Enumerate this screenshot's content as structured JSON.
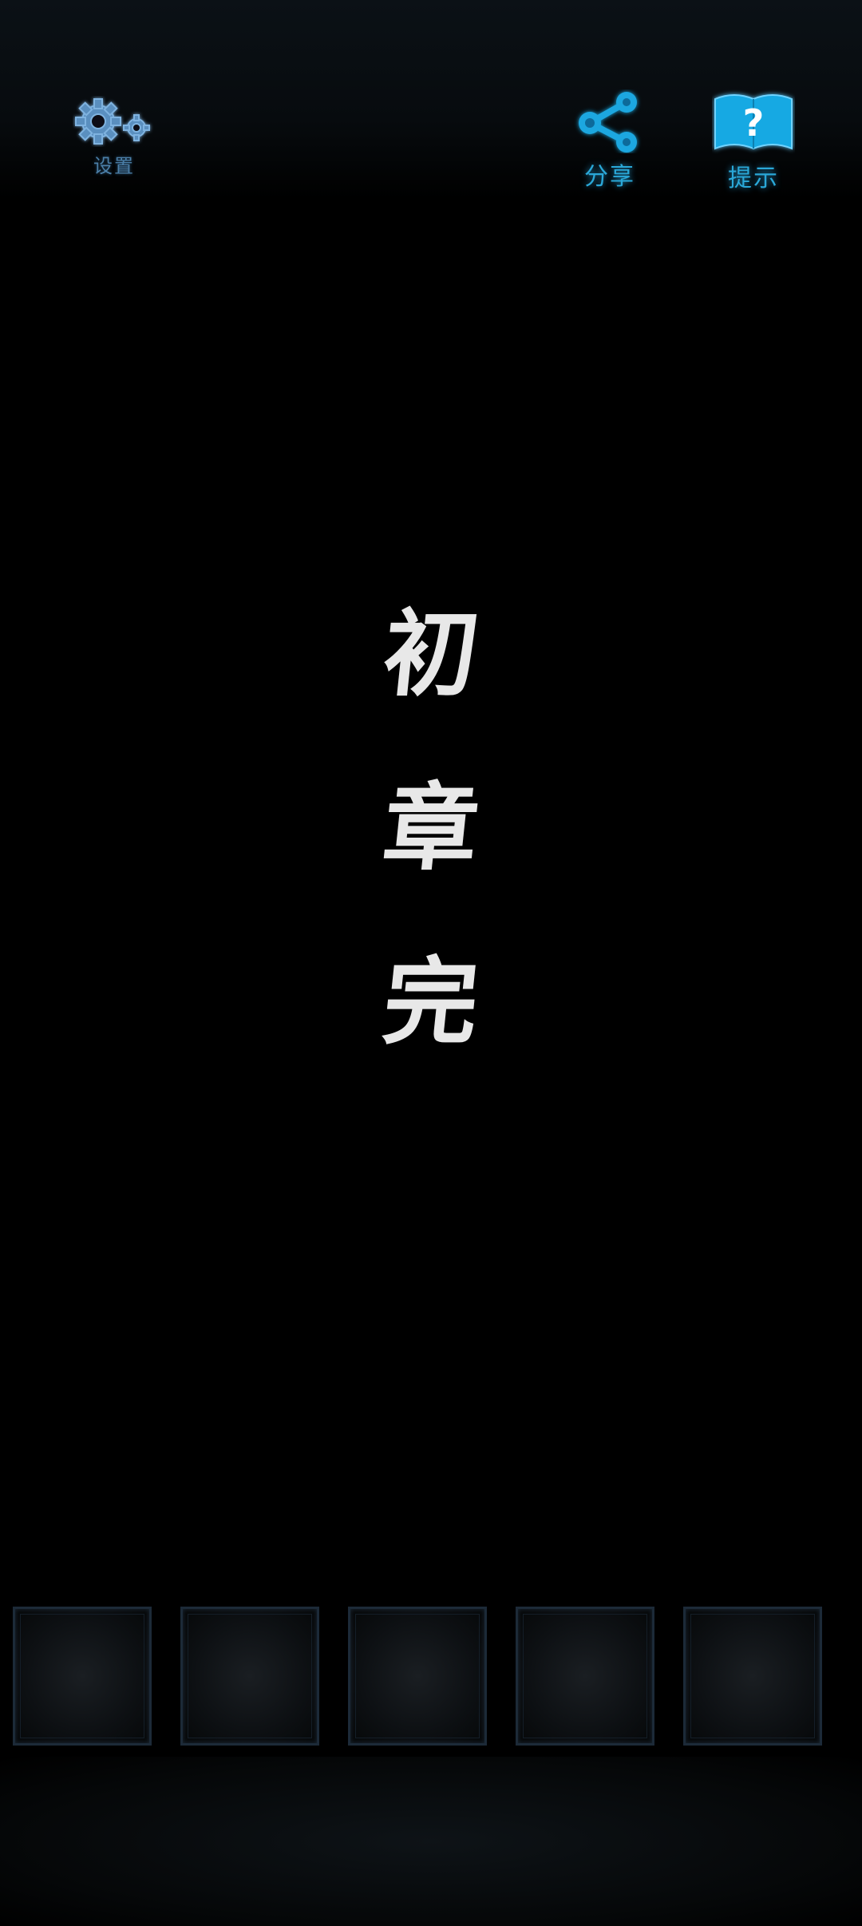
{
  "toolbar": {
    "settings_label": "设置",
    "share_label": "分享",
    "hint_label": "提示"
  },
  "icons": {
    "settings": "gears-icon",
    "share": "share-icon",
    "hint": "hint-book-icon"
  },
  "colors": {
    "accent": "#2aa8d8",
    "settings_tint": "#4b7fa8",
    "title_text": "#e8e8e8",
    "background": "#000000",
    "slot_border": "#1c2a38"
  },
  "chapter": {
    "chars": [
      "初",
      "章",
      "完"
    ]
  },
  "inventory": {
    "slot_count": 5
  }
}
